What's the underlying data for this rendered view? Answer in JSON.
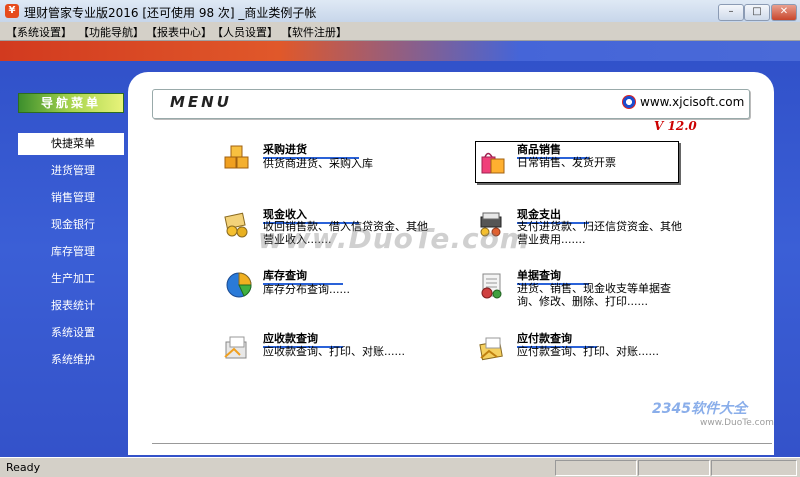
{
  "window": {
    "title": "理财管家专业版2016 [还可使用 98 次] _商业类例子帐",
    "minimize": "–",
    "maximize": "□",
    "close": "✕"
  },
  "menubar": [
    "【系统设置】",
    "【功能导航】",
    "【报表中心】",
    "【人员设置】",
    "【软件注册】"
  ],
  "sidebar": {
    "header": "导航菜单",
    "items": [
      "快捷菜单",
      "进货管理",
      "销售管理",
      "现金银行",
      "库存管理",
      "生产加工",
      "报表统计",
      "系统设置",
      "系统维护"
    ]
  },
  "banner": {
    "logo": "MENU",
    "url": "www.xjcisoft.com",
    "version": "V 12.0"
  },
  "features": [
    {
      "title": "采购进货",
      "desc": "供货商进货、采购入库",
      "icon": "boxes-icon"
    },
    {
      "title": "商品销售",
      "desc": "日常销售、发货开票",
      "icon": "shopping-bag-icon"
    },
    {
      "title": "现金收入",
      "desc": "收回销售款、借入信贷资金、其他营业收入.......",
      "icon": "cash-in-icon"
    },
    {
      "title": "现金支出",
      "desc": "支付进货款、归还信贷资金、其他营业费用.......",
      "icon": "cash-out-icon"
    },
    {
      "title": "库存查询",
      "desc": "库存分布查询......",
      "icon": "pie-chart-icon"
    },
    {
      "title": "单据查询",
      "desc": "进货、销售、现金收支等单据查询、修改、删除、打印......",
      "icon": "document-icon"
    },
    {
      "title": "应收款查询",
      "desc": "应收款查询、打印、对账......",
      "icon": "receivable-icon"
    },
    {
      "title": "应付款查询",
      "desc": "应付款查询、打印、对账......",
      "icon": "payable-icon"
    }
  ],
  "watermark": {
    "text": "www.DuoTe.com",
    "corner": "2345软件大全",
    "corner_url": "www.DuoTe.com"
  },
  "status": {
    "text": "Ready"
  }
}
